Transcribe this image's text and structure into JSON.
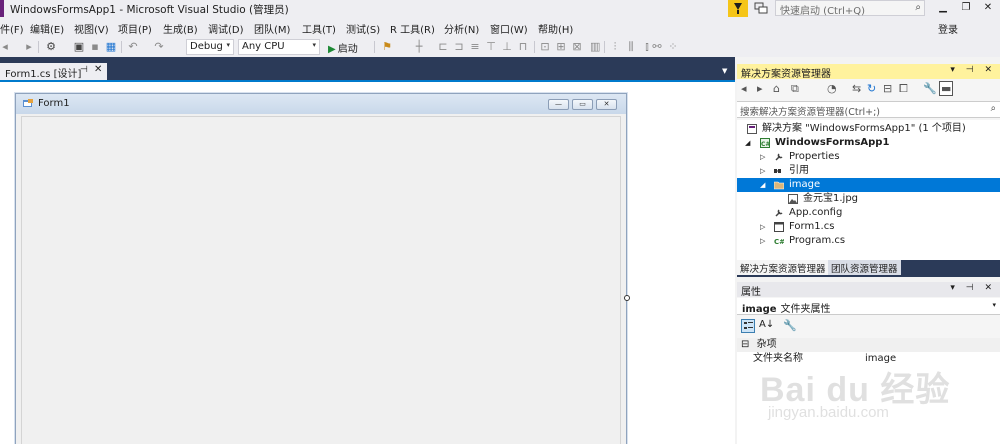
{
  "window": {
    "title": "WindowsFormsApp1 - Microsoft Visual Studio (管理员)",
    "accent_color": "#68217a",
    "notification_icon": "flag-icon",
    "feedback_icon": "feedback-icon",
    "quick_launch_placeholder": "快速启动 (Ctrl+Q)",
    "search_icon": "search-icon",
    "controls": [
      "minimize-icon",
      "restore-icon",
      "close-icon"
    ]
  },
  "menu": {
    "items": [
      "件(F)",
      "编辑(E)",
      "视图(V)",
      "项目(P)",
      "生成(B)",
      "调试(D)",
      "团队(M)",
      "工具(T)",
      "测试(S)",
      "R 工具(R)",
      "分析(N)",
      "窗口(W)",
      "帮助(H)"
    ],
    "login": "登录"
  },
  "toolbar": {
    "config": "Debug",
    "platform": "Any CPU",
    "start": "启动",
    "dropdown_arrow": "▾"
  },
  "document": {
    "tab_label": "Form1.cs [设计]",
    "pin_glyph": "⊣",
    "close_glyph": "✕",
    "active_color": "#007acc"
  },
  "form": {
    "title": "Form1",
    "buttons": [
      "▭",
      "▭",
      "✕"
    ]
  },
  "solution_explorer": {
    "title": "解决方案资源管理器",
    "header_icons": "▾ ⊣ ✕",
    "header_color": "#fff29d",
    "search_placeholder": "搜索解决方案资源管理器(Ctrl+;)",
    "search_icon": "search-icon",
    "tree": [
      {
        "label": "解决方案 \"WindowsFormsApp1\" (1 个项目)",
        "icon": "solution-icon",
        "expander": "",
        "bold": false
      },
      {
        "label": "WindowsFormsApp1",
        "icon": "csharp-project-icon",
        "expander": "◢",
        "bold": true
      },
      {
        "label": "Properties",
        "icon": "wrench-icon",
        "expander": "▷",
        "bold": false
      },
      {
        "label": "引用",
        "icon": "references-icon",
        "expander": "▷",
        "bold": false
      },
      {
        "label": "image",
        "icon": "folder-icon",
        "expander": "◢",
        "bold": false,
        "selected": true
      },
      {
        "label": "金元宝1.jpg",
        "icon": "image-file-icon",
        "expander": "",
        "bold": false
      },
      {
        "label": "App.config",
        "icon": "config-icon",
        "expander": "",
        "bold": false
      },
      {
        "label": "Form1.cs",
        "icon": "form-icon",
        "expander": "▷",
        "bold": false
      },
      {
        "label": "Program.cs",
        "icon": "csharp-file-icon",
        "expander": "▷",
        "bold": false
      }
    ],
    "selection_color": "#0078d7",
    "tabs": [
      "解决方案资源管理器",
      "团队资源管理器"
    ]
  },
  "properties": {
    "title": "属性",
    "header_icons": "▾ ⊣ ✕",
    "object_name": "image",
    "object_type": "文件夹属性",
    "category": "杂项",
    "collapse_glyph": "⊟",
    "rows": [
      {
        "name": "文件夹名称",
        "value": "image"
      }
    ]
  },
  "watermark": {
    "logo": "Bai du 经验",
    "url": "jingyan.baidu.com"
  }
}
